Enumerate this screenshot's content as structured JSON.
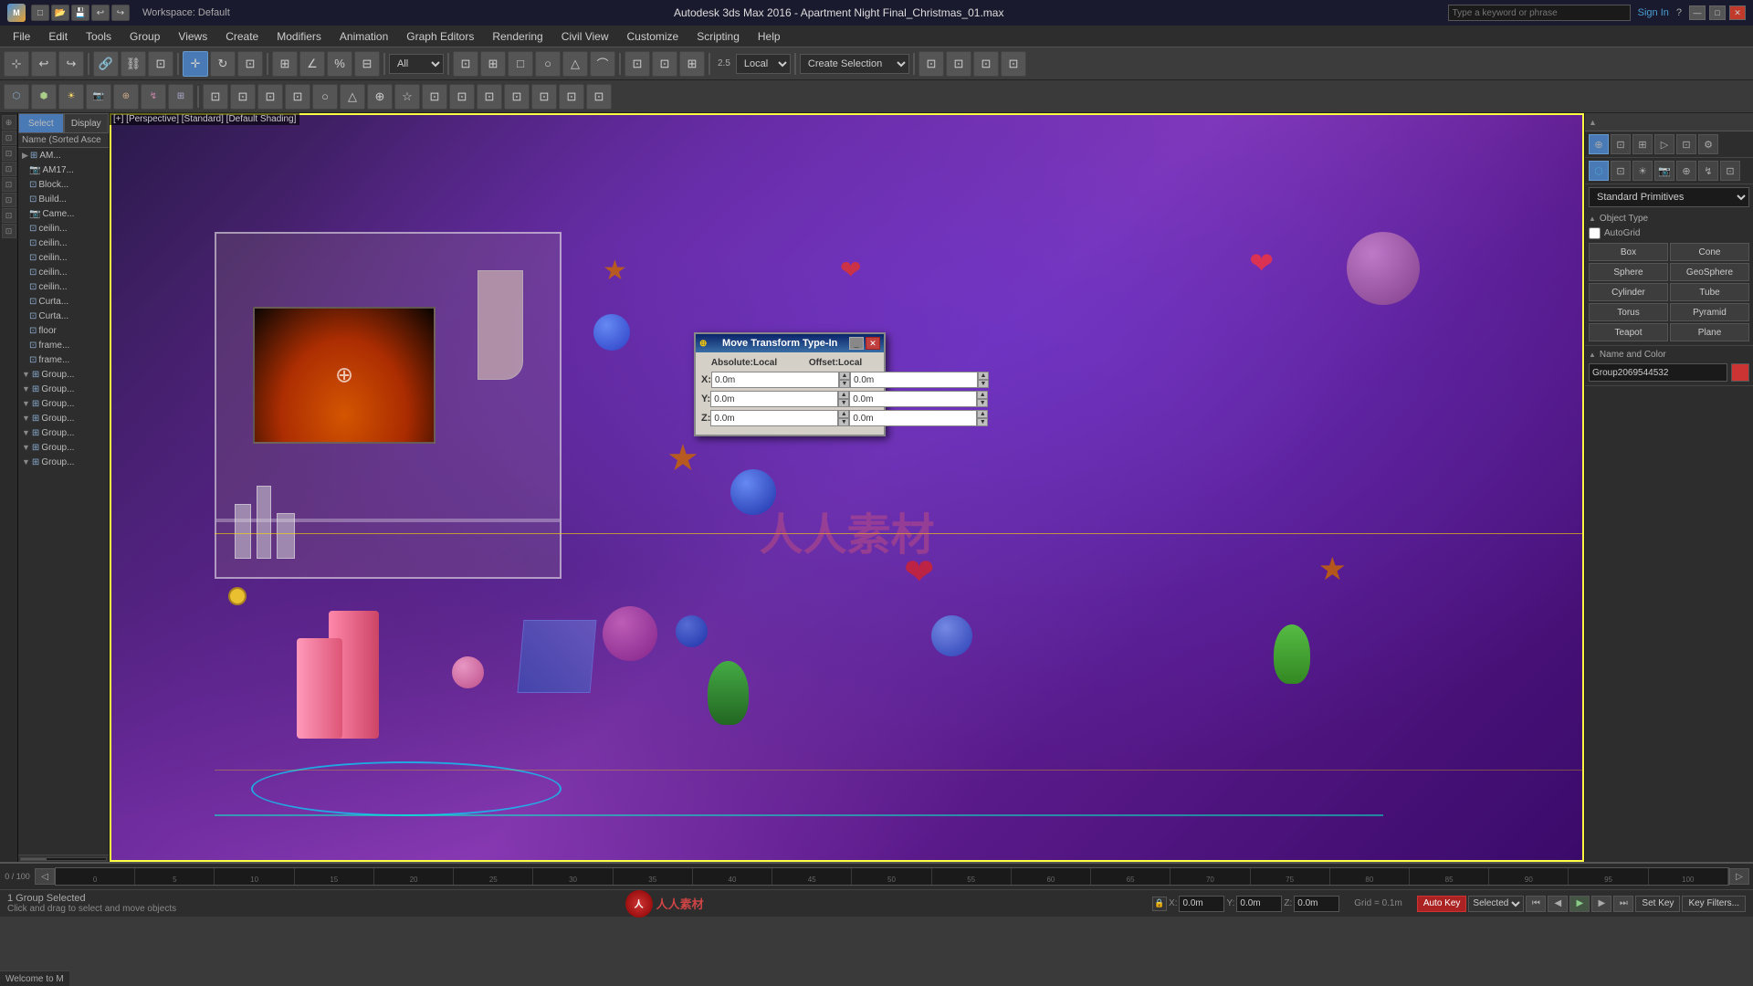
{
  "titlebar": {
    "app_icon": "3ds-max-icon",
    "title": "Autodesk 3ds Max 2016 - Apartment Night Final_Christmas_01.max",
    "search_placeholder": "Type a keyword or phrase",
    "sign_in": "Sign In",
    "min_btn": "—",
    "max_btn": "□",
    "close_btn": "✕"
  },
  "menubar": {
    "items": [
      "File",
      "Edit",
      "Tools",
      "Group",
      "Views",
      "Create",
      "Modifiers",
      "Animation",
      "Graph Editors",
      "Rendering",
      "Civil View",
      "Customize",
      "Scripting",
      "Help"
    ]
  },
  "toolbar1": {
    "workspace_label": "Workspace: Default",
    "buttons": [
      "↩",
      "↩",
      "↪",
      "✕",
      "□",
      "⊡",
      "⊡",
      "⊡",
      "⊡",
      "⊡"
    ]
  },
  "toolbar2": {
    "filter_dropdown": "All",
    "coord_dropdown": "Local",
    "select_dropdown": "Create Selection",
    "buttons": [
      "⊕",
      "⊡",
      "⊡",
      "○",
      "△",
      "⊡",
      "⊡",
      "⊡",
      "⊡",
      "⊡"
    ]
  },
  "left_panel": {
    "tabs": [
      "Select",
      "Display"
    ],
    "scene_header": "Name (Sorted Asce",
    "items": [
      {
        "name": "AM...",
        "indent": 0
      },
      {
        "name": "AM17...",
        "indent": 1
      },
      {
        "name": "Block...",
        "indent": 1
      },
      {
        "name": "Build...",
        "indent": 1
      },
      {
        "name": "Came...",
        "indent": 1
      },
      {
        "name": "ceilin...",
        "indent": 1
      },
      {
        "name": "ceilin...",
        "indent": 1
      },
      {
        "name": "ceilin...",
        "indent": 1
      },
      {
        "name": "ceilin...",
        "indent": 1
      },
      {
        "name": "ceilin...",
        "indent": 1
      },
      {
        "name": "Curta...",
        "indent": 1
      },
      {
        "name": "Curta...",
        "indent": 1
      },
      {
        "name": "floor",
        "indent": 1
      },
      {
        "name": "frame...",
        "indent": 1
      },
      {
        "name": "frame...",
        "indent": 1
      },
      {
        "name": "Group...",
        "indent": 0
      },
      {
        "name": "Group...",
        "indent": 0
      },
      {
        "name": "Group...",
        "indent": 0
      },
      {
        "name": "Group...",
        "indent": 0
      },
      {
        "name": "Group...",
        "indent": 0
      },
      {
        "name": "Group...",
        "indent": 0
      },
      {
        "name": "Group...",
        "indent": 0
      }
    ]
  },
  "move_transform_dialog": {
    "title": "Move Transform Type-In",
    "absolute_label": "Absolute:Local",
    "offset_label": "Offset:Local",
    "x_abs": "0.0m",
    "y_abs": "0.0m",
    "z_abs": "0.0m",
    "x_off": "0.0m",
    "y_off": "0.0m",
    "z_off": "0.0m",
    "x_label": "X:",
    "y_label": "Y:",
    "z_label": "Z:"
  },
  "right_panel": {
    "primitives_dropdown": "Standard Primitives",
    "object_type_title": "Object Type",
    "autogrid_label": "AutoGrid",
    "objects": [
      "Box",
      "Cone",
      "Sphere",
      "GeoSphere",
      "Cylinder",
      "Tube",
      "Torus",
      "Pyramid",
      "Teapot",
      "Plane"
    ],
    "name_color_title": "Name and Color",
    "name_value": "Group2069544532"
  },
  "status_bar": {
    "group_selected": "1 Group Selected",
    "hint": "Click and drag to select and move objects",
    "welcome": "Welcome to M",
    "x_label": "X:",
    "y_label": "Y:",
    "z_label": "Z:",
    "x_val": "0.0m",
    "y_val": "0.0m",
    "z_val": "0.0m",
    "grid_label": "Grid = 0.1m",
    "auto_key": "Auto Key",
    "selected_label": "Selected",
    "set_key": "Set Key",
    "key_filters": "Key Filters..."
  },
  "viewport": {
    "corner_label": "[+] [Perspective] [Standard] [Default Shading]",
    "timeline_start": "0",
    "timeline_end": "100",
    "time_marks": [
      "0",
      "5",
      "10",
      "15",
      "20",
      "25",
      "30",
      "35",
      "40",
      "45",
      "50",
      "55",
      "60",
      "65",
      "70",
      "75",
      "80",
      "85",
      "90",
      "95",
      "100"
    ]
  },
  "icons": {
    "move": "⊕",
    "rotate": "↻",
    "scale": "⊡",
    "select": "→",
    "zoom": "🔍",
    "play": "▶",
    "stop": "■",
    "prev": "⏮",
    "next": "⏭",
    "prev_frame": "◀",
    "next_frame": "▶"
  }
}
